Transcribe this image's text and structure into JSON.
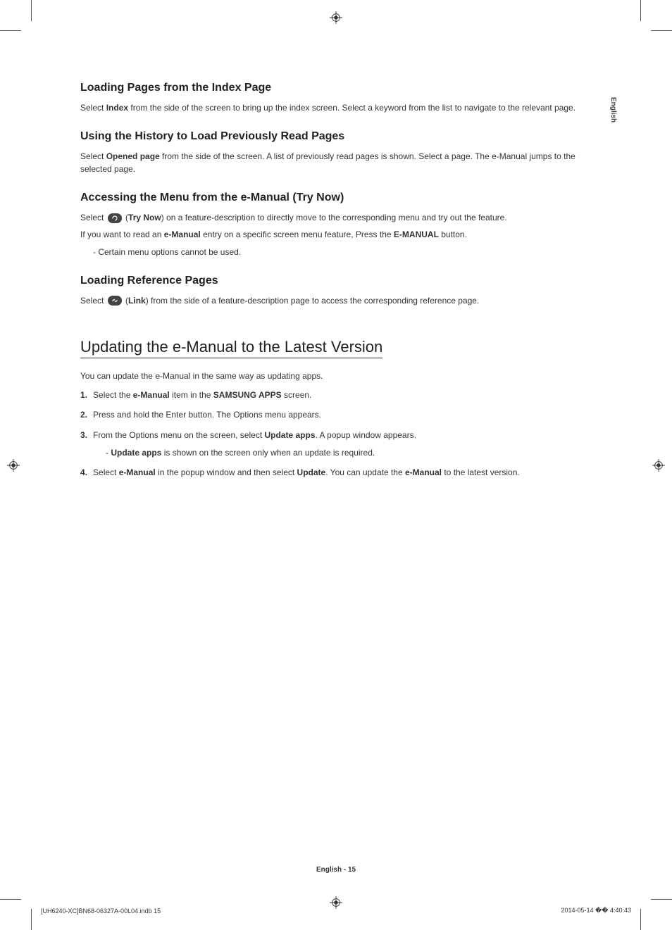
{
  "lang_tab": "English",
  "s1": {
    "heading": "Loading Pages from the Index Page",
    "p1_a": "Select ",
    "p1_b": "Index",
    "p1_c": " from the side of the screen to bring up the index screen. Select a keyword from the list to navigate to the relevant page."
  },
  "s2": {
    "heading": "Using the History to Load Previously Read Pages",
    "p1_a": "Select ",
    "p1_b": "Opened page",
    "p1_c": " from the side of the screen. A list of previously read pages is shown. Select a page. The e-Manual jumps to the selected page."
  },
  "s3": {
    "heading": "Accessing the Menu from the e-Manual (Try Now)",
    "p1_a": "Select ",
    "p1_b": " (",
    "p1_c": "Try Now",
    "p1_d": ") on a feature-description to directly move to the corresponding menu and try out the feature.",
    "p2_a": "If you want to read an ",
    "p2_b": "e-Manual",
    "p2_c": " entry on a specific screen menu feature, Press the ",
    "p2_d": "E-MANUAL",
    "p2_e": " button.",
    "dash1": "Certain menu options cannot be used."
  },
  "s4": {
    "heading": "Loading Reference Pages",
    "p1_a": "Select ",
    "p1_b": " (",
    "p1_c": "Link",
    "p1_d": ") from the side of a feature-description page to access the corresponding reference page."
  },
  "s5": {
    "heading": "Updating the e-Manual to the Latest Version",
    "intro": "You can update the e-Manual in the same way as updating apps.",
    "li1_a": "Select the ",
    "li1_b": "e-Manual",
    "li1_c": " item in the ",
    "li1_d": "SAMSUNG APPS",
    "li1_e": " screen.",
    "li2": "Press and hold the Enter button. The Options menu appears.",
    "li3_a": "From the Options menu on the screen, select ",
    "li3_b": "Update apps",
    "li3_c": ". A popup window appears.",
    "li3_dash_a": "Update apps",
    "li3_dash_b": " is shown on the screen only when an update is required.",
    "li4_a": "Select ",
    "li4_b": "e-Manual",
    "li4_c": " in the popup window and then select ",
    "li4_d": "Update",
    "li4_e": ". You can update the ",
    "li4_f": "e-Manual",
    "li4_g": " to the latest version."
  },
  "footer": {
    "page": "English - 15",
    "left": "[UH6240-XC]BN68-06327A-00L04.indb   15",
    "right": "2014-05-14   �� 4:40:43"
  }
}
